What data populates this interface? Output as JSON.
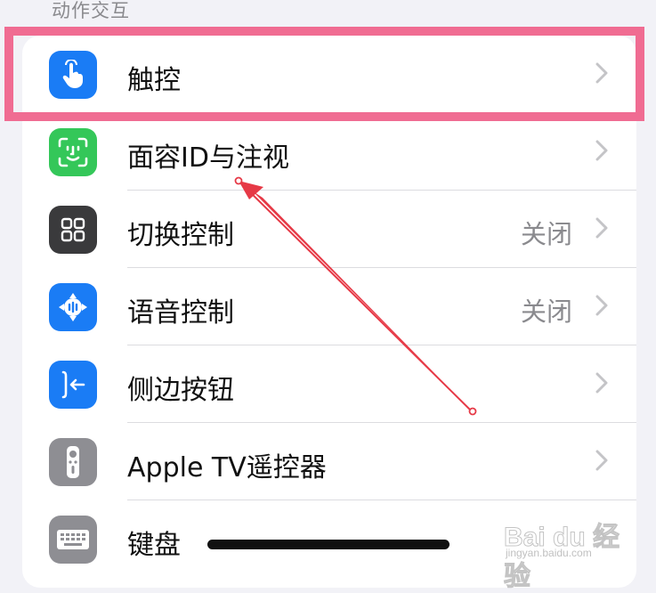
{
  "section": {
    "header": "动作交互"
  },
  "rows": [
    {
      "label": "触控",
      "value": "",
      "icon": "touch-hand-icon",
      "color": "#1a7cf5"
    },
    {
      "label": "面容ID与注视",
      "value": "",
      "icon": "face-id-icon",
      "color": "#34c759"
    },
    {
      "label": "切换控制",
      "value": "关闭",
      "icon": "switch-control-icon",
      "color": "#3a3a3c"
    },
    {
      "label": "语音控制",
      "value": "关闭",
      "icon": "voice-control-icon",
      "color": "#1a7cf5"
    },
    {
      "label": "侧边按钮",
      "value": "",
      "icon": "side-button-icon",
      "color": "#1a7cf5"
    },
    {
      "label": "Apple TV遥控器",
      "value": "",
      "icon": "apple-tv-remote-icon",
      "color": "#8e8e93"
    },
    {
      "label": "键盘",
      "value": "",
      "icon": "keyboard-icon",
      "color": "#8e8e93"
    }
  ],
  "colors": {
    "highlight": "#f06c92",
    "annotation_arrow": "#e63946"
  },
  "watermark": {
    "main": "Bai du 经验",
    "sub": "jingyan.baidu.com"
  }
}
